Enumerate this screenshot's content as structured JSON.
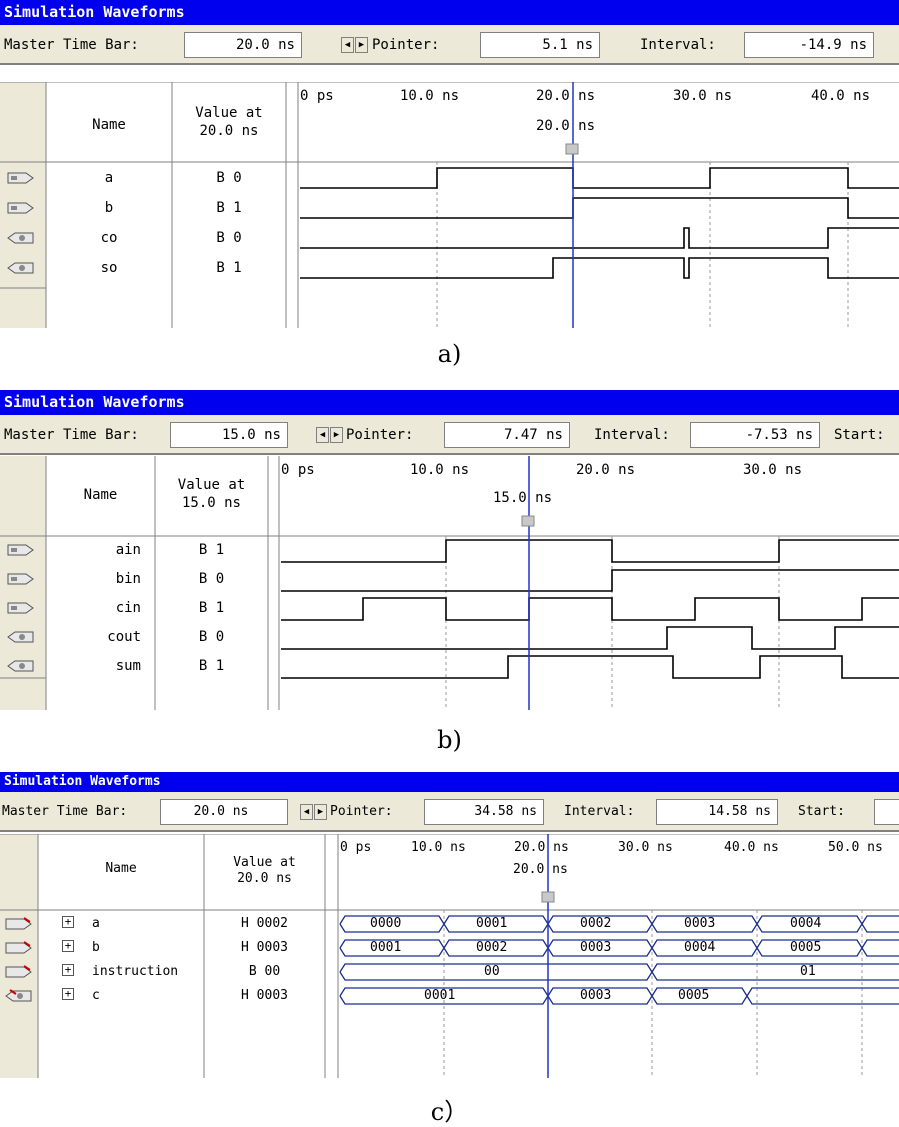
{
  "panels": [
    {
      "id": "a",
      "title": "Simulation Waveforms",
      "toolbar": {
        "master_label": "Master Time Bar:",
        "master_value": "20.0 ns",
        "pointer_label": "Pointer:",
        "pointer_value": "5.1 ns",
        "interval_label": "Interval:",
        "interval_value": "-14.9 ns"
      },
      "header": {
        "name": "Name",
        "value_at": "Value at",
        "value_time": "20.0 ns"
      },
      "ticks": [
        "0 ps",
        "10.0 ns",
        "20.0 ns",
        "30.0 ns",
        "40.0 ns"
      ],
      "cursor_label": "20.0 ns",
      "signals": [
        {
          "name": "a",
          "value": "B 0",
          "icon": "input-pin-icon"
        },
        {
          "name": "b",
          "value": "B 1",
          "icon": "input-pin-icon"
        },
        {
          "name": "co",
          "value": "B 0",
          "icon": "output-pin-icon"
        },
        {
          "name": "so",
          "value": "B 1",
          "icon": "output-pin-icon"
        }
      ],
      "caption": "a)"
    },
    {
      "id": "b",
      "title": "Simulation Waveforms",
      "toolbar": {
        "master_label": "Master Time Bar:",
        "master_value": "15.0 ns",
        "pointer_label": "Pointer:",
        "pointer_value": "7.47 ns",
        "interval_label": "Interval:",
        "interval_value": "-7.53 ns",
        "start_label": "Start:"
      },
      "header": {
        "name": "Name",
        "value_at": "Value at",
        "value_time": "15.0 ns"
      },
      "ticks": [
        "0 ps",
        "10.0 ns",
        "20.0 ns",
        "30.0 ns"
      ],
      "cursor_label": "15.0 ns",
      "signals": [
        {
          "name": "ain",
          "value": "B 1",
          "icon": "input-pin-icon"
        },
        {
          "name": "bin",
          "value": "B 0",
          "icon": "input-pin-icon"
        },
        {
          "name": "cin",
          "value": "B 1",
          "icon": "input-pin-icon"
        },
        {
          "name": "cout",
          "value": "B 0",
          "icon": "output-pin-icon"
        },
        {
          "name": "sum",
          "value": "B 1",
          "icon": "output-pin-icon"
        }
      ],
      "caption": "b)"
    },
    {
      "id": "c",
      "title": "Simulation Waveforms",
      "toolbar": {
        "master_label": "Master Time Bar:",
        "master_value": "20.0 ns",
        "pointer_label": "Pointer:",
        "pointer_value": "34.58 ns",
        "interval_label": "Interval:",
        "interval_value": "14.58 ns",
        "start_label": "Start:"
      },
      "header": {
        "name": "Name",
        "value_at": "Value at",
        "value_time": "20.0 ns"
      },
      "ticks": [
        "0 ps",
        "10.0 ns",
        "20.0 ns",
        "30.0 ns",
        "40.0 ns",
        "50.0 ns"
      ],
      "cursor_label": "20.0 ns",
      "signals": [
        {
          "name": "a",
          "value": "H 0002",
          "icon": "input-bus-icon",
          "expand": "+"
        },
        {
          "name": "b",
          "value": "H 0003",
          "icon": "input-bus-icon",
          "expand": "+"
        },
        {
          "name": "instruction",
          "value": "B 00",
          "icon": "input-bus-icon",
          "expand": "+"
        },
        {
          "name": "c",
          "value": "H 0003",
          "icon": "output-bus-icon",
          "expand": "+"
        }
      ],
      "bus_values": {
        "a": [
          "0000",
          "0001",
          "0002",
          "0003",
          "0004"
        ],
        "b": [
          "0001",
          "0002",
          "0003",
          "0004",
          "0005"
        ],
        "instruction": [
          "00",
          "01"
        ],
        "c": [
          "0001",
          "0003",
          "0005"
        ]
      },
      "caption": "c）"
    }
  ]
}
